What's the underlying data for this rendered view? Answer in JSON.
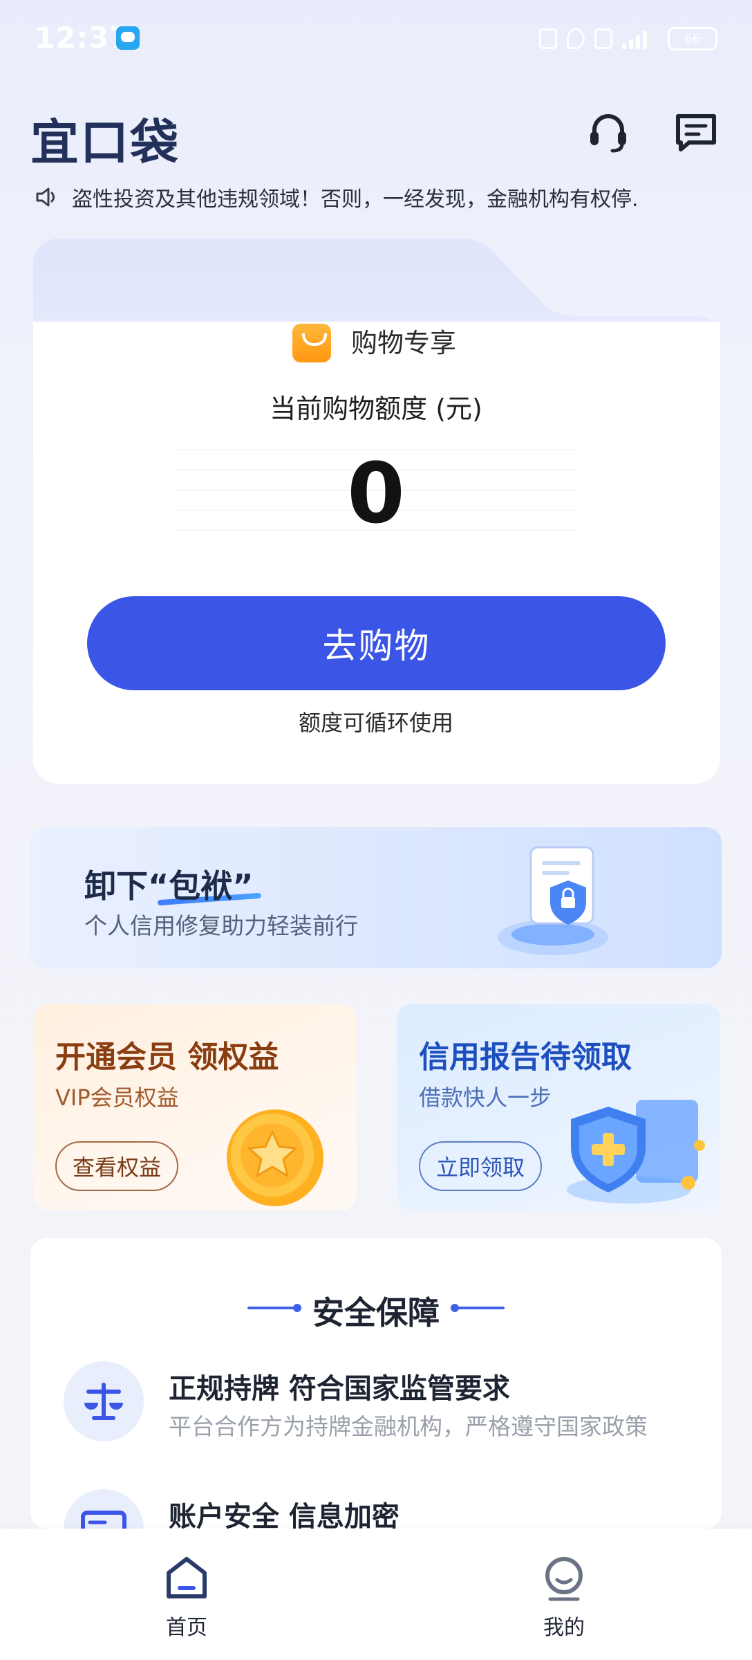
{
  "status_bar": {
    "time": "12:37",
    "battery": "66"
  },
  "header": {
    "logo": "宜口袋"
  },
  "notice": {
    "text": "盗性投资及其他违规领域！否则，一经发现，金融机构有权停."
  },
  "quota_card": {
    "badge_label": "购物专享",
    "label": "当前购物额度 (元)",
    "value": "0",
    "button": "去购物",
    "note": "额度可循环使用"
  },
  "banner": {
    "title": "卸下“包袱”",
    "subtitle": "个人信用修复助力轻装前行"
  },
  "vip_card": {
    "title": "开通会员 领权益",
    "subtitle": "VIP会员权益",
    "button": "查看权益"
  },
  "credit_card": {
    "title": "信用报告待领取",
    "subtitle": "借款快人一步",
    "button": "立即领取"
  },
  "safety": {
    "title": "安全保障",
    "items": [
      {
        "title": "正规持牌 符合国家监管要求",
        "subtitle": "平台合作方为持牌金融机构，严格遵守国家政策"
      },
      {
        "title": "账户安全 信息加密",
        "subtitle": ""
      }
    ]
  },
  "nav": {
    "home": "首页",
    "me": "我的"
  },
  "colors": {
    "primary": "#3b55e6",
    "logo": "#22315a",
    "vip_text": "#8a3d10",
    "credit_text": "#1e4fbf"
  }
}
